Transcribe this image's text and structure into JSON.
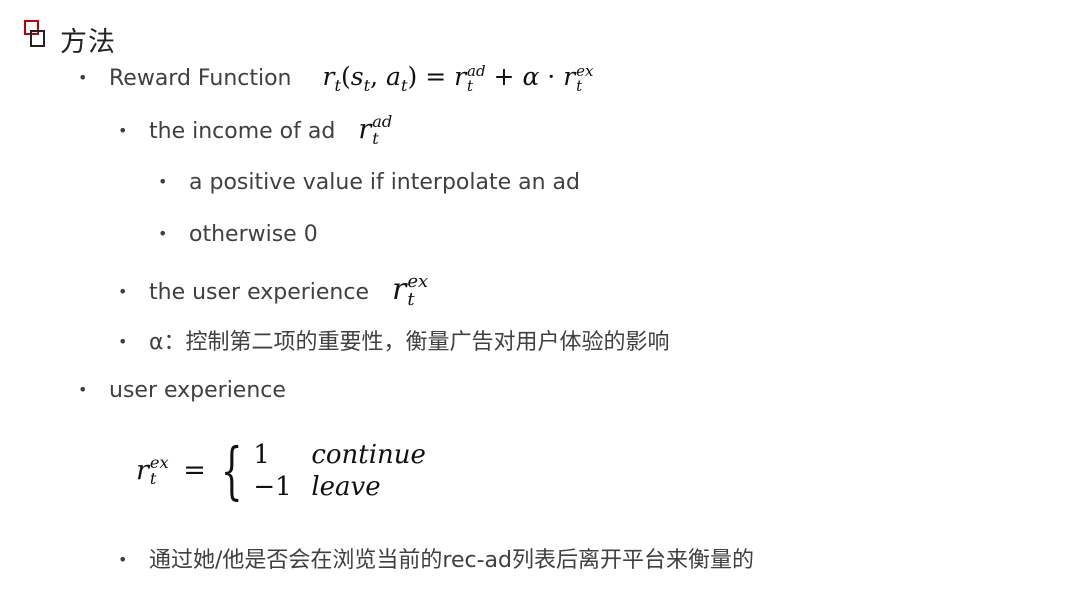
{
  "header": {
    "title": "方法",
    "logo_icon": "overlapping-squares-icon",
    "accent_color": "#c00000"
  },
  "bullets": [
    {
      "level": 1,
      "text": "Reward Function",
      "formula": "r_t(s_t, a_t) = r_t^{ad} + α · r_t^{ex}"
    },
    {
      "level": 2,
      "text": "the income of ad",
      "formula": "r_t^{ad}"
    },
    {
      "level": 3,
      "text": "a positive value if interpolate an ad"
    },
    {
      "level": 3,
      "text": "otherwise 0"
    },
    {
      "level": 2,
      "text": "the user experience",
      "formula": "r_t^{ex}"
    },
    {
      "level": 2,
      "text": "α：控制第二项的重要性，衡量广告对用户体验的影响"
    },
    {
      "level": 1,
      "text": "user experience"
    },
    {
      "level": 2,
      "text": "通过她/他是否会在浏览当前的rec-ad列表后离开平台来衡量的"
    }
  ],
  "math": {
    "r": "r",
    "t": "t",
    "s": "s",
    "a": "a",
    "ad": "ad",
    "ex": "ex",
    "alpha": "α",
    "eq": "=",
    "plus": "+",
    "dot": "·",
    "lparen": "(",
    "rparen": ")",
    "comma": ",",
    "cases": [
      {
        "value": "1",
        "label": "continue"
      },
      {
        "value": "−1",
        "label": "leave"
      }
    ]
  },
  "bullet_glyph": "•"
}
